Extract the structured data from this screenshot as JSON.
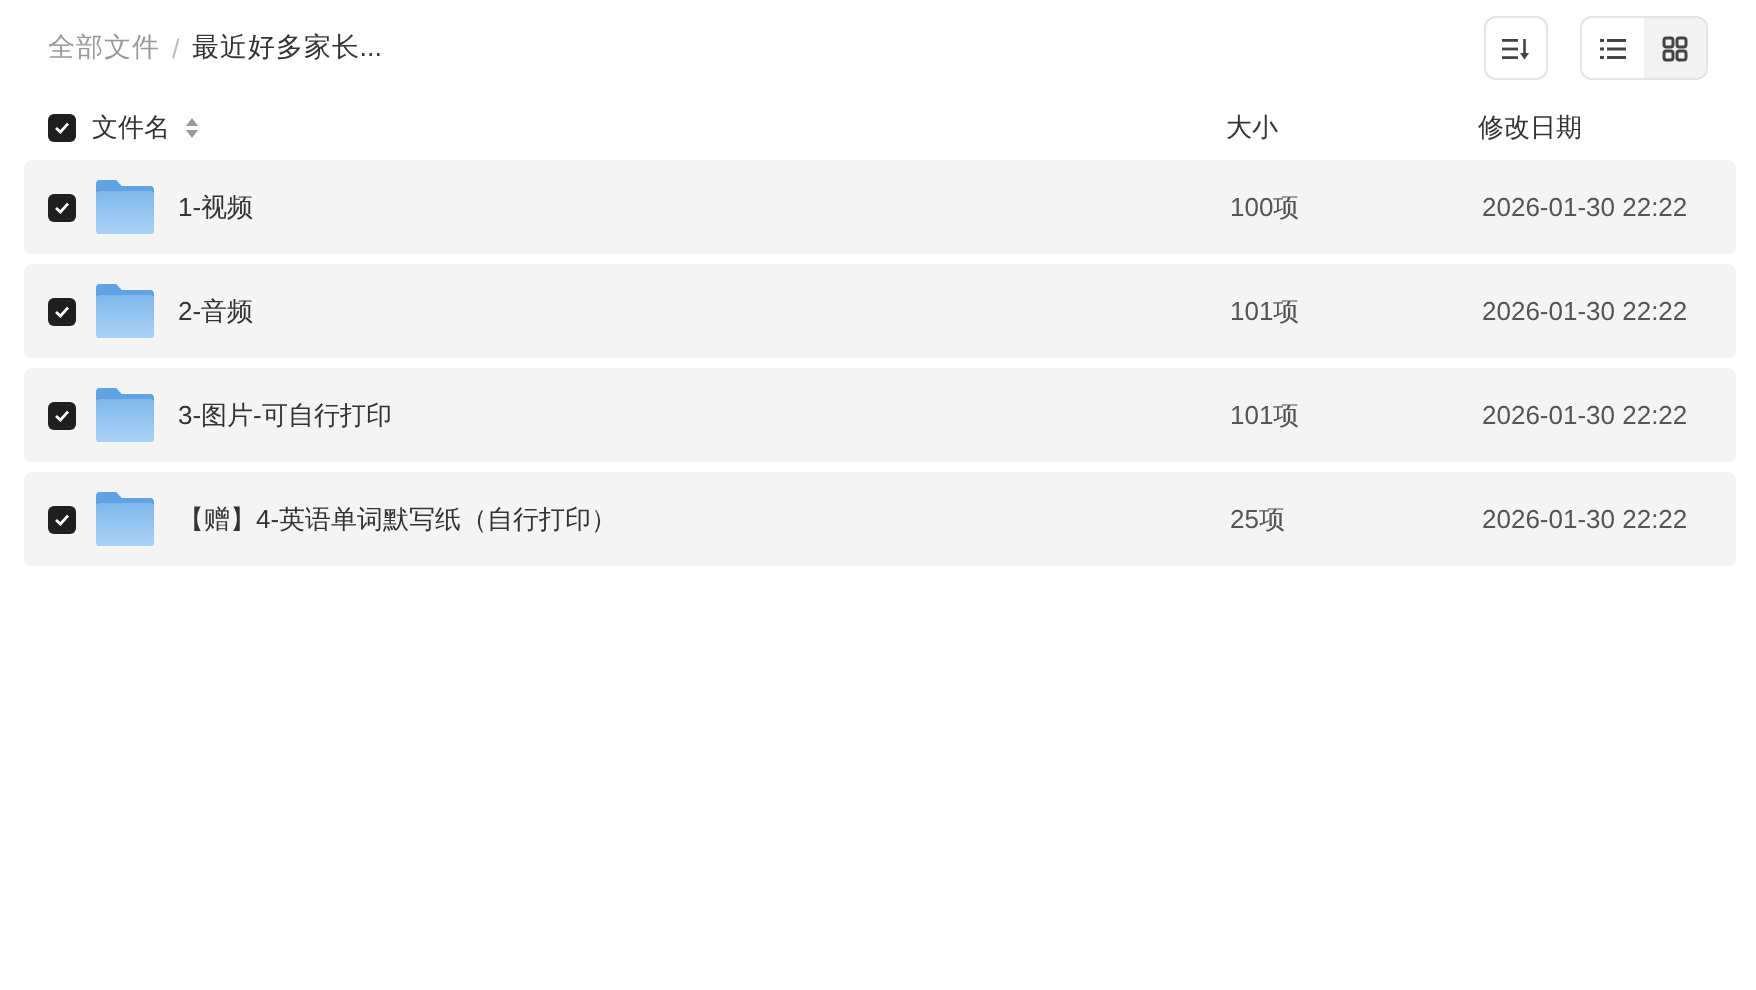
{
  "breadcrumb_separator": "/",
  "breadcrumb": [
    {
      "label": "全部文件",
      "current": false
    },
    {
      "label": "最近好多家长...",
      "current": true
    }
  ],
  "toolbar": {
    "view_modes": [
      {
        "kind": "list",
        "selected": true
      },
      {
        "kind": "grid",
        "selected": false
      }
    ]
  },
  "table": {
    "select_all_checked": true,
    "columns": [
      "文件名",
      "大小",
      "修改日期"
    ],
    "rows": [
      {
        "name": "1-视频",
        "size": "100项",
        "modified": "2026-01-30 22:22",
        "checked": true
      },
      {
        "name": "2-音频",
        "size": "101项",
        "modified": "2026-01-30 22:22",
        "checked": true
      },
      {
        "name": "3-图片-可自行打印",
        "size": "101项",
        "modified": "2026-01-30 22:22",
        "checked": true
      },
      {
        "name": "【赠】4-英语单词默写纸（自行打印）",
        "size": "25项",
        "modified": "2026-01-30 22:22",
        "checked": true
      }
    ]
  }
}
